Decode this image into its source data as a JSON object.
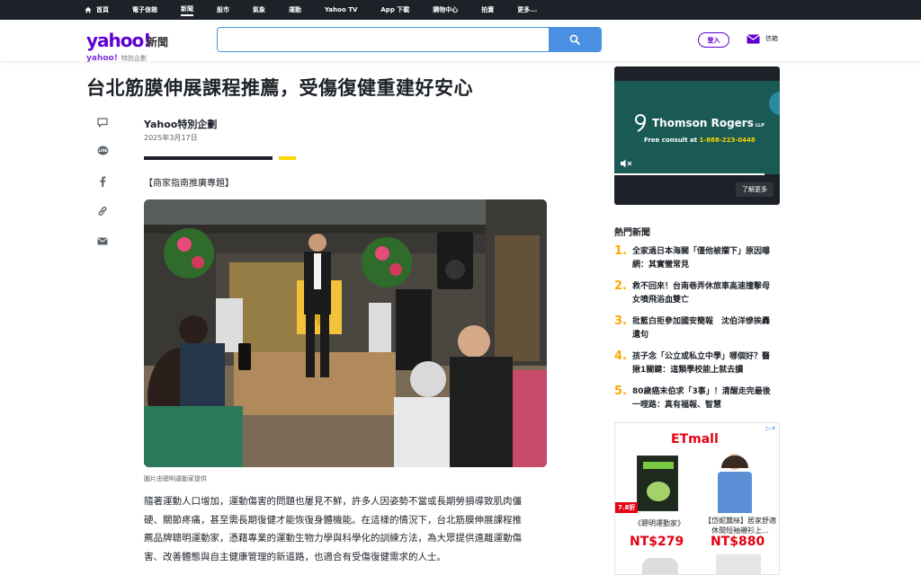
{
  "nav": {
    "items": [
      {
        "label": "首頁",
        "active": false
      },
      {
        "label": "電子信箱",
        "active": false
      },
      {
        "label": "新聞",
        "active": true
      },
      {
        "label": "股市",
        "active": false
      },
      {
        "label": "氣象",
        "active": false
      },
      {
        "label": "運動",
        "active": false
      },
      {
        "label": "Yahoo TV",
        "active": false
      },
      {
        "label": "App 下載",
        "active": false
      },
      {
        "label": "購物中心",
        "active": false
      },
      {
        "label": "拍賣",
        "active": false
      },
      {
        "label": "更多...",
        "active": false
      }
    ]
  },
  "header": {
    "logo": "yahoo!",
    "logo_sub": "新聞",
    "search_placeholder": "",
    "login_label": "登入",
    "mail_label": "信箱"
  },
  "article": {
    "brand": "yahoo!",
    "brand_sub": "特別企劃",
    "title": "台北筋膜伸展課程推薦，受傷復健重建好安心",
    "author": "Yahoo特別企劃",
    "date": "2025年3月17日",
    "tag": "【商家指南推廣專題】",
    "photo_caption": "圖片由聰明運動家提供",
    "paragraph_lines": [
      "隨著運動人口增加，運動傷害的問題也屢見不鮮，許多人因姿勢不當或長期勞損導致肌肉僵",
      "硬、關節疼痛，甚至需長期復健才能恢復身體機能。在這樣的情況下，台北筋膜伸展課程推",
      "薦品牌聰明運動家，憑藉專業的運動生物力學與科學化的訓練方法，為大眾提供遠離運動傷",
      "害、改善體態與自主健康管理的新道路，也適合有受傷復健需求的人士。"
    ],
    "share_icons": [
      "comment-icon",
      "line-icon",
      "facebook-icon",
      "link-icon",
      "mail-icon"
    ]
  },
  "ad_video": {
    "brand": "Thomson Rogers",
    "brand_suffix": "LLP",
    "sub_text": "Free consult at",
    "phone": "1-888-223-0448",
    "learn_more": "了解更多"
  },
  "hot_news": {
    "title": "熱門新聞",
    "items": [
      {
        "num": "1.",
        "text": "全家過日本海關「僅他被攔下」原因曝　網：其實蠻常見"
      },
      {
        "num": "2.",
        "text": "救不回來！台南巷弄休旅車高速撞擊母女噴飛浴血雙亡"
      },
      {
        "num": "3.",
        "text": "批藍白拒參加國安簡報　沈伯洋慘挨轟遺句"
      },
      {
        "num": "4.",
        "text": "孩子念「公立或私立中學」哪個好？醫揪1關鍵：這類學校能上就去讀"
      },
      {
        "num": "5.",
        "text": "80歲癌末伯求「3事」！清醒走完最後一哩路：真有福報、智慧"
      }
    ]
  },
  "ad_etmall": {
    "brand": "ETmall",
    "discount": "7.8折",
    "products": [
      {
        "label": "《聰明運動家》",
        "price": "NT$279"
      },
      {
        "label": "【岱妮蠶絲】居家舒適休閒短袖襯衫上...",
        "price": "NT$880"
      }
    ]
  },
  "colors": {
    "nav_bg": "#1d2228",
    "brand_purple": "#6001d2",
    "search_blue": "#4a90e2",
    "hot_number": "#ffa700",
    "price_red": "#e60012"
  }
}
